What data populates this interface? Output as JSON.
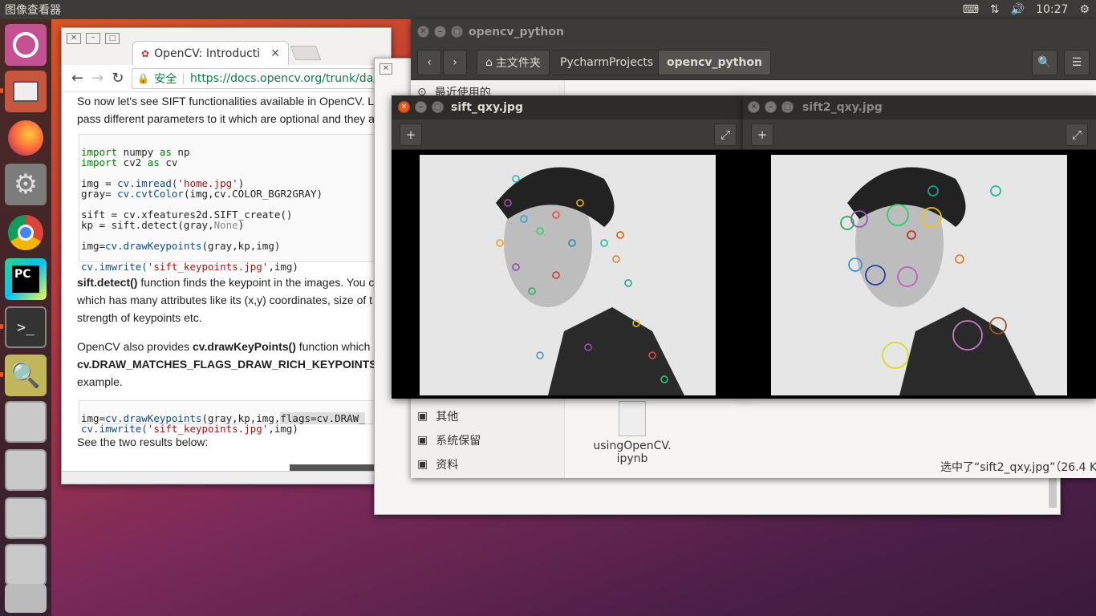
{
  "topbar": {
    "app_title": "图像查看器",
    "time": "10:27"
  },
  "chrome": {
    "tab_title": "OpenCV: Introducti",
    "secure_label": "安全",
    "url": "https://docs.opencv.org/trunk/da/d",
    "para1_line1": "So now let's see SIFT functionalities available in OpenCV. L",
    "para1_line2": "pass different parameters to it which are optional and they a",
    "code1": {
      "l1a": "import",
      "l1b": " numpy ",
      "l1c": "as",
      "l1d": " np",
      "l2a": "import",
      "l2b": " cv2 ",
      "l2c": "as",
      "l2d": " cv",
      "l3a": "img = ",
      "l3b": "cv.imread(",
      "l3c": "'home.jpg'",
      "l3d": ")",
      "l4a": "gray= ",
      "l4b": "cv.cvtColor",
      "l4c": "(img,cv.COLOR_BGR2GRAY)",
      "l5": "sift = cv.xfeatures2d.SIFT_create()",
      "l6a": "kp = sift.detect(gray,",
      "l6b": "None",
      "l6c": ")",
      "l7a": "img=",
      "l7b": "cv.drawKeypoints",
      "l7c": "(gray,kp,img)",
      "l8a": "cv.imwrite(",
      "l8b": "'sift_keypoints.jpg'",
      "l8c": ",img)"
    },
    "para2_bold": "sift.detect()",
    "para2_rest": " function finds the keypoint in the images. You c",
    "para2_line2": "which has many attributes like its (x,y) coordinates, size of t",
    "para2_line3": "strength of keypoints etc.",
    "para3_a": "OpenCV also provides ",
    "para3_bold": "cv.drawKeyPoints()",
    "para3_b": " function which",
    "para3_line2": "cv.DRAW_MATCHES_FLAGS_DRAW_RICH_KEYPOINTS",
    "para3_line3": "example.",
    "code2": {
      "l1a": "img=",
      "l1b": "cv.drawKeypoints",
      "l1c": "(gray,kp,img,",
      "l1d": "flags=cv.DRAW_",
      "l2a": "cv.imwrite(",
      "l2b": "'sift_keypoints.jpg'",
      "l2c": ",img)"
    },
    "para4": "See the two results below:"
  },
  "nautilus": {
    "title": "opencv_python",
    "path": [
      "主文件夹",
      "PycharmProjects",
      "opencv_python"
    ],
    "recent": "最近使用的",
    "sidebar": [
      "其他",
      "系统保留",
      "资料"
    ],
    "file_name": "usingOpenCV.\nipynb",
    "status": "选中了“sift2_qxy.jpg”（26.4 K"
  },
  "viewer1": {
    "title": "sift_qxy.jpg"
  },
  "viewer2": {
    "title": "sift2_qxy.jpg"
  }
}
